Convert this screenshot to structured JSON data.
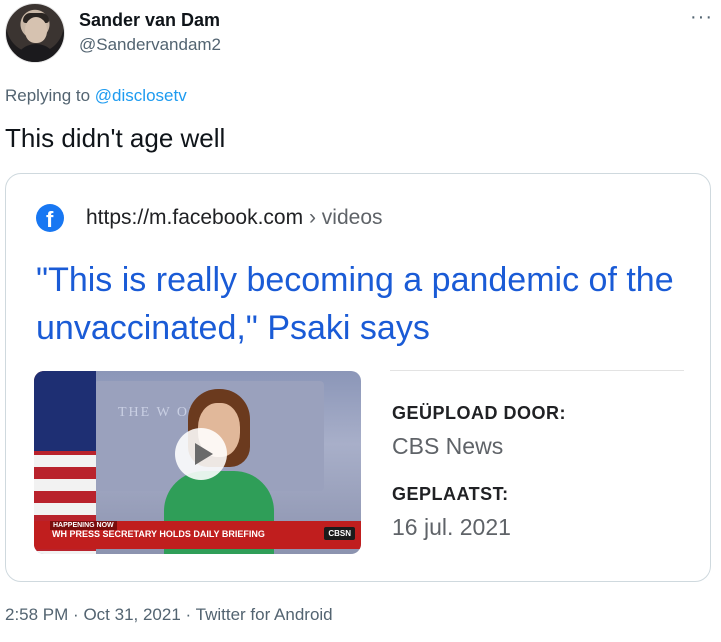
{
  "author": {
    "display_name": "Sander van Dam",
    "handle": "@Sandervandam2"
  },
  "more_icon": "···",
  "reply": {
    "prefix": "Replying to",
    "mention": "@disclosetv"
  },
  "tweet_text": "This didn't age well",
  "card": {
    "source_url": "https://m.facebook.com",
    "separator": "›",
    "source_path": "videos",
    "headline": "\"This is really becoming a pandemic of the unvaccinated,\" Psaki says",
    "uploader_label": "GEÜPLOAD DOOR:",
    "uploader_value": "CBS News",
    "posted_label": "GEPLAATST:",
    "posted_value": "16 jul. 2021",
    "thumbnail": {
      "wall_text": "THE W        OUSE",
      "tag": "HAPPENING NOW",
      "lower_third": "WH PRESS SECRETARY HOLDS DAILY BRIEFING",
      "logo": "CBSN"
    }
  },
  "footer": {
    "time": "2:58 PM",
    "dot1": "·",
    "date": "Oct 31, 2021",
    "dot2": "·",
    "source_app": "Twitter for Android"
  },
  "colors": {
    "link": "#1d9bf0",
    "headline": "#1a5bd6",
    "facebook": "#1877f2"
  }
}
